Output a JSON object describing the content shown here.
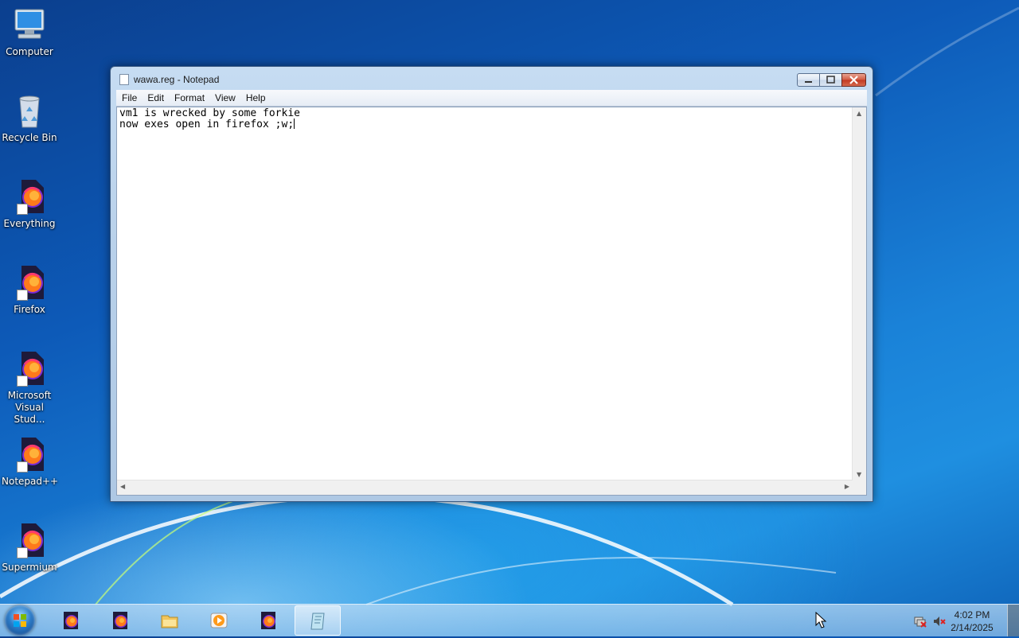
{
  "desktop": {
    "icons": [
      {
        "label": "Computer",
        "icon": "computer-icon"
      },
      {
        "label": "Recycle Bin",
        "icon": "recycle-bin-icon"
      },
      {
        "label": "Everything",
        "icon": "firefox-shortcut-icon"
      },
      {
        "label": "Firefox",
        "icon": "firefox-shortcut-icon"
      },
      {
        "label": "Microsoft Visual Stud...",
        "icon": "firefox-shortcut-icon"
      },
      {
        "label": "Notepad++",
        "icon": "firefox-shortcut-icon"
      },
      {
        "label": "Supermium",
        "icon": "firefox-shortcut-icon"
      }
    ]
  },
  "window": {
    "title": "wawa.reg - Notepad",
    "menu": [
      "File",
      "Edit",
      "Format",
      "View",
      "Help"
    ],
    "content_lines": [
      "vm1 is wrecked by some forkie",
      "now exes open in firefox ;w;"
    ]
  },
  "taskbar": {
    "pinned": [
      "firefox-icon",
      "firefox-icon",
      "explorer-folder-icon",
      "media-player-icon",
      "firefox-icon",
      "notepad-icon"
    ],
    "active_index": 5,
    "clock_time": "4:02 PM",
    "clock_date": "2/14/2025"
  },
  "colors": {
    "accent": "#1a82d8",
    "close_button": "#c23a22",
    "firefox_orange": "#ff7a1a",
    "firefox_purple": "#7a2bd6"
  }
}
